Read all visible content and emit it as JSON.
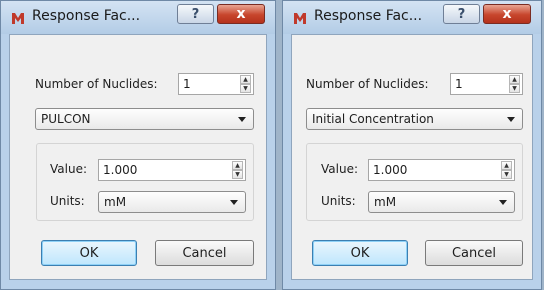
{
  "dialogs": [
    {
      "title": "Response Fac...",
      "help_glyph": "?",
      "close_glyph": "x",
      "nuclides_label": "Number of Nuclides:",
      "nuclides_value": "1",
      "parameter_selected": "PULCON",
      "value_label": "Value:",
      "value_value": "1.000",
      "units_label": "Units:",
      "units_selected": "mM",
      "ok_label": "OK",
      "cancel_label": "Cancel"
    },
    {
      "title": "Response Fac...",
      "help_glyph": "?",
      "close_glyph": "x",
      "nuclides_label": "Number of Nuclides:",
      "nuclides_value": "1",
      "parameter_selected": "Initial Concentration",
      "value_label": "Value:",
      "value_value": "1.000",
      "units_label": "Units:",
      "units_selected": "mM",
      "ok_label": "OK",
      "cancel_label": "Cancel"
    }
  ],
  "icons": {
    "app": "app-logo-icon",
    "spin_up": "spin-up-icon",
    "spin_down": "spin-down-icon",
    "dropdown": "chevron-down-icon"
  },
  "colors": {
    "title_bar": "#b9d1ea",
    "close_button": "#c7452c",
    "default_button": "#bee6fd",
    "client_area": "#f0f0f0"
  }
}
